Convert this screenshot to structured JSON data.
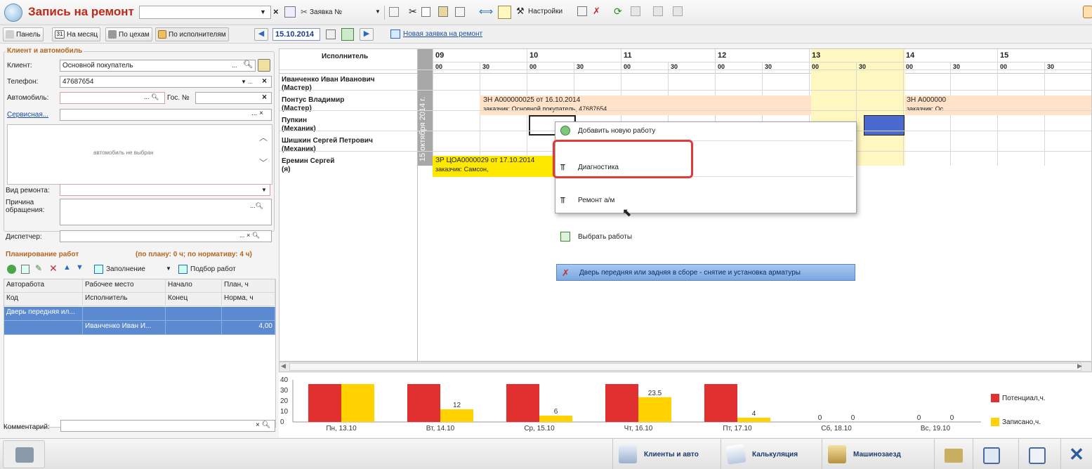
{
  "window": {
    "title": "Запись на ремонт",
    "search_value": "",
    "order_label": "Заявка №",
    "settings_label": "Настройки"
  },
  "toolbar2": {
    "panel": "Панель",
    "month_icon": "31",
    "month": "На месяц",
    "shops": "По цехам",
    "executors": "По исполнителям",
    "date": "15.10.2014",
    "new_order_link": "Новая заявка на ремонт"
  },
  "client": {
    "group_title": "Клиент и автомобиль",
    "client_label": "Клиент:",
    "client_value": "Основной покупатель",
    "phone_label": "Телефон:",
    "phone_value": "47687654",
    "car_label": "Автомобиль:",
    "car_value": "",
    "plate_label": "Гос. №",
    "plate_value": "",
    "service_label": "Сервисная...",
    "service_value": "",
    "car_placeholder": "автомобиль не выбран",
    "repair_type_label": "Вид ремонта:",
    "reason_label": "Причина обращения:",
    "dispatcher_label": "Диспетчер:",
    "comment_label": "Комментарий:"
  },
  "planning": {
    "title": "Планирование работ",
    "summary": "(по плану: 0 ч; по нормативу: 4 ч)",
    "fill_label": "Заполнение",
    "select_label": "Подбор работ",
    "headers1": [
      "Авторабота",
      "Рабочее место",
      "Начало",
      "План, ч"
    ],
    "headers2": [
      "Код",
      "Исполнитель",
      "Конец",
      "Норма, ч"
    ],
    "row1": [
      "Дверь передняя ил...",
      "",
      "",
      ""
    ],
    "row2": [
      "",
      "Иванченко Иван И...",
      "",
      "4,00"
    ]
  },
  "schedule": {
    "header": "Исполнитель",
    "date_vertical": "15 октября 2014 г.",
    "hours": [
      "09",
      "10",
      "11",
      "12",
      "13",
      "14",
      "15"
    ],
    "minutes": [
      "00",
      "30",
      "00",
      "30",
      "00",
      "30",
      "00",
      "30",
      "00",
      "30",
      "00",
      "30",
      "00",
      "30"
    ],
    "workers": [
      {
        "name": "Иванченко Иван Иванович",
        "role": "(Мастер)"
      },
      {
        "name": "Понтус Владимир",
        "role": "(Мастер)"
      },
      {
        "name": "Пупкин",
        "role": "(Механик)"
      },
      {
        "name": "Шишкин Сергей Петрович",
        "role": "(Механик)"
      },
      {
        "name": "Еремин Сергей",
        "role": "(я)"
      }
    ],
    "bookings": [
      {
        "line1": "ЗН А000000025 от 16.10.2014",
        "line2": "заказчик: Основной покупатель, 47687654"
      },
      {
        "line1": "ЗН А000000",
        "line2": "заказчик: Ос"
      },
      {
        "line1": "ЗР ЦОА0000029 от 17.10.2014",
        "line2": "заказчик: Самсон,"
      }
    ]
  },
  "context_menu": {
    "items": [
      "Добавить новую работу",
      "Диагностика",
      "Ремонт а/м",
      "Выбрать работы",
      "Дверь передняя или задняя в сборе - снятие и установка арматуры"
    ]
  },
  "chart_data": {
    "type": "bar",
    "categories": [
      "Пн, 13.10",
      "Вт, 14.10",
      "Ср, 15.10",
      "Чт, 16.10",
      "Пт, 17.10",
      "Сб, 18.10",
      "Вс, 19.10"
    ],
    "series": [
      {
        "name": "Потенциал,ч.",
        "color": "#e03030",
        "values": [
          36,
          36,
          36,
          36,
          36,
          0,
          0
        ]
      },
      {
        "name": "Записано,ч.",
        "color": "#ffd200",
        "values": [
          36,
          12,
          6,
          23.5,
          4,
          0,
          0
        ]
      }
    ],
    "labels": [
      [
        null,
        null
      ],
      [
        null,
        "12"
      ],
      [
        null,
        "6"
      ],
      [
        null,
        "23.5"
      ],
      [
        null,
        "4"
      ],
      [
        "0",
        "0"
      ],
      [
        "0",
        "0"
      ]
    ],
    "yticks": [
      "40",
      "30",
      "20",
      "10",
      "0"
    ],
    "ylim": [
      0,
      40
    ]
  },
  "bottom": {
    "clients": "Клиенты и авто",
    "calc": "Калькуляция",
    "carwash": "Машинозаезд"
  }
}
